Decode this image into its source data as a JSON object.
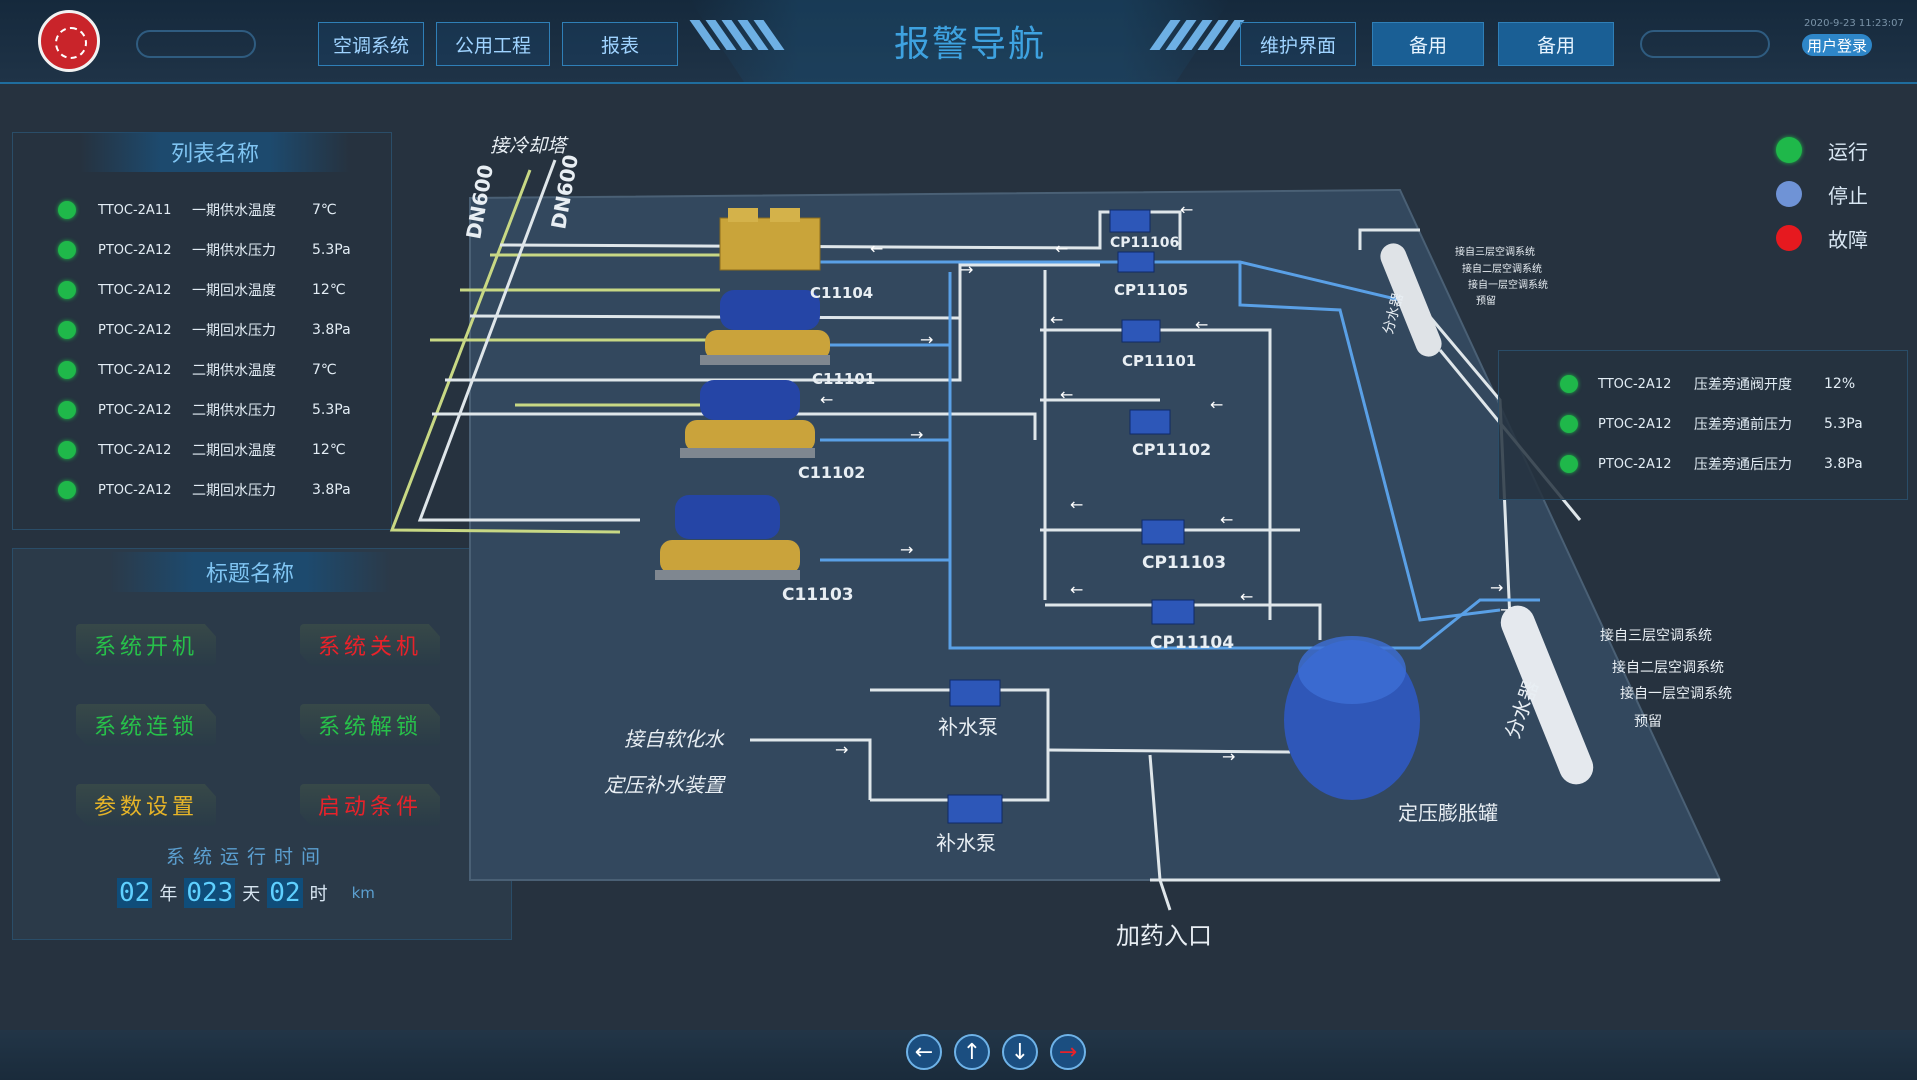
{
  "header": {
    "title": "报警导航",
    "nav_left": [
      "空调系统",
      "公用工程",
      "报表"
    ],
    "nav_right": [
      "维护界面",
      "备用",
      "备用"
    ],
    "datetime": "2020-9-23 11:23:07",
    "login_label": "用户登录"
  },
  "list_panel": {
    "title": "列表名称",
    "rows": [
      {
        "tag": "TTOC-2A11",
        "name": "一期供水温度",
        "value": "7℃"
      },
      {
        "tag": "PTOC-2A12",
        "name": "一期供水压力",
        "value": "5.3Pa"
      },
      {
        "tag": "TTOC-2A12",
        "name": "一期回水温度",
        "value": "12℃"
      },
      {
        "tag": "PTOC-2A12",
        "name": "一期回水压力",
        "value": "3.8Pa"
      },
      {
        "tag": "TTOC-2A12",
        "name": "二期供水温度",
        "value": "7℃"
      },
      {
        "tag": "PTOC-2A12",
        "name": "二期供水压力",
        "value": "5.3Pa"
      },
      {
        "tag": "TTOC-2A12",
        "name": "二期回水温度",
        "value": "12℃"
      },
      {
        "tag": "PTOC-2A12",
        "name": "二期回水压力",
        "value": "3.8Pa"
      }
    ]
  },
  "control_panel": {
    "title": "标题名称",
    "buttons": [
      {
        "label": "系统开机",
        "color": "#27c04a"
      },
      {
        "label": "系统关机",
        "color": "#e8222a"
      },
      {
        "label": "系统连锁",
        "color": "#27c04a"
      },
      {
        "label": "系统解锁",
        "color": "#27c04a"
      },
      {
        "label": "参数设置",
        "color": "#e6b428"
      },
      {
        "label": "启动条件",
        "color": "#e8222a"
      }
    ],
    "runtime_label": "系统运行时间",
    "runtime": {
      "years": "02",
      "year_unit": "年",
      "days": "023",
      "day_unit": "天",
      "hours": "02",
      "hour_unit": "时",
      "extra_unit": "km"
    }
  },
  "legend": [
    {
      "label": "运行",
      "color": "#1fb84a"
    },
    {
      "label": "停止",
      "color": "#6f93d6"
    },
    {
      "label": "故障",
      "color": "#e6191f"
    }
  ],
  "bypass_panel": {
    "rows": [
      {
        "tag": "TTOC-2A12",
        "name": "压差旁通阀开度",
        "value": "12%"
      },
      {
        "tag": "PTOC-2A12",
        "name": "压差旁通前压力",
        "value": "5.3Pa"
      },
      {
        "tag": "PTOC-2A12",
        "name": "压差旁通后压力",
        "value": "3.8Pa"
      }
    ]
  },
  "diagram": {
    "cooling_tower_label": "接冷却塔",
    "pipe_labels": [
      "DN600",
      "DN600"
    ],
    "chillers": [
      "C11104",
      "C11101",
      "C11102",
      "C11103"
    ],
    "pumps": [
      "CP11106",
      "CP11105",
      "CP11101",
      "CP11102",
      "CP11103",
      "CP11104"
    ],
    "collector_label": "分水器",
    "distributor_label": "分水器",
    "collector_lines": [
      "接自三层空调系统",
      "接自二层空调系统",
      "接自一层空调系统",
      "预留"
    ],
    "distributor_lines": [
      "接自三层空调系统",
      "接自二层空调系统",
      "接自一层空调系统",
      "预留"
    ],
    "makeup_pump_label": "补水泵",
    "soft_water_label": "接自软化水",
    "makeup_device_label": "定压补水装置",
    "expansion_tank_label": "定压膨胀罐",
    "dosing_label": "加药入口"
  },
  "bottom_nav": [
    "left-arrow",
    "up-arrow",
    "down-arrow",
    "right-arrow"
  ],
  "colors": {
    "pipe_supply": "#5aa0e6",
    "pipe_return": "#cfd6dc",
    "pipe_cooling": "#cfe08a",
    "floor": "#33485e"
  }
}
